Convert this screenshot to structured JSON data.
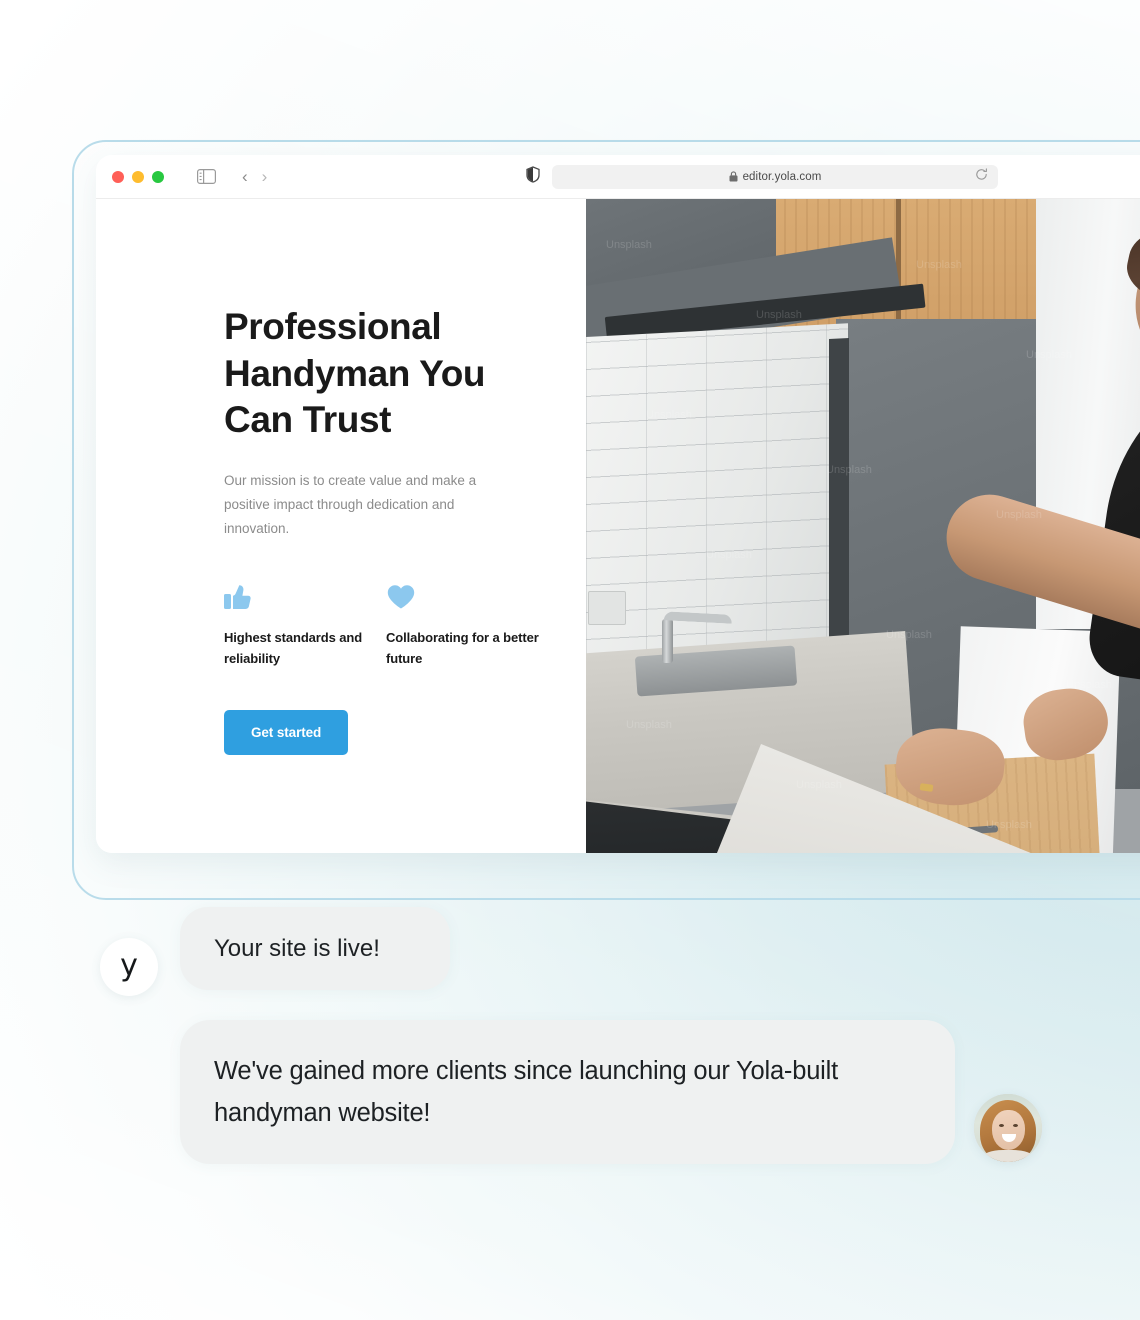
{
  "browser": {
    "window_controls": [
      {
        "name": "close",
        "color": "#ff5f57"
      },
      {
        "name": "minimize",
        "color": "#febc2e"
      },
      {
        "name": "maximize",
        "color": "#28c840"
      }
    ],
    "sidebar_toggle_icon": "sidebar-icon",
    "back_icon": "chevron-left-icon",
    "forward_icon": "chevron-right-icon",
    "privacy_icon": "shield-icon",
    "lock_icon": "lock-icon",
    "url": "editor.yola.com",
    "reload_icon": "reload-icon"
  },
  "hero": {
    "title": "Professional Handyman You Can Trust",
    "subtitle": "Our mission is to create value and make a positive impact through dedication and innovation.",
    "features": [
      {
        "icon": "thumbs-up-icon",
        "label": "Highest standards and reliability"
      },
      {
        "icon": "heart-icon",
        "label": "Collaborating for a better future"
      }
    ],
    "cta_label": "Get started",
    "cta_color": "#2f9fe0",
    "icon_color": "#8cc8ee",
    "photo_alt": "handyman-installing-kitchen-cooktop",
    "photo_watermark": "Unsplash"
  },
  "testimonial": {
    "brand_avatar_letter": "y",
    "messages": [
      {
        "text": "Your site is live!",
        "sender": "yola"
      },
      {
        "text": "We've gained more clients since launching our Yola-built handyman website!",
        "sender": "customer"
      }
    ],
    "customer_avatar_alt": "smiling-woman-portrait"
  },
  "theme": {
    "background_accent": "#cfe7ec",
    "frame_border": "#b9dcea",
    "bubble_background": "#eff1f1",
    "text_dark": "#1d2124"
  }
}
